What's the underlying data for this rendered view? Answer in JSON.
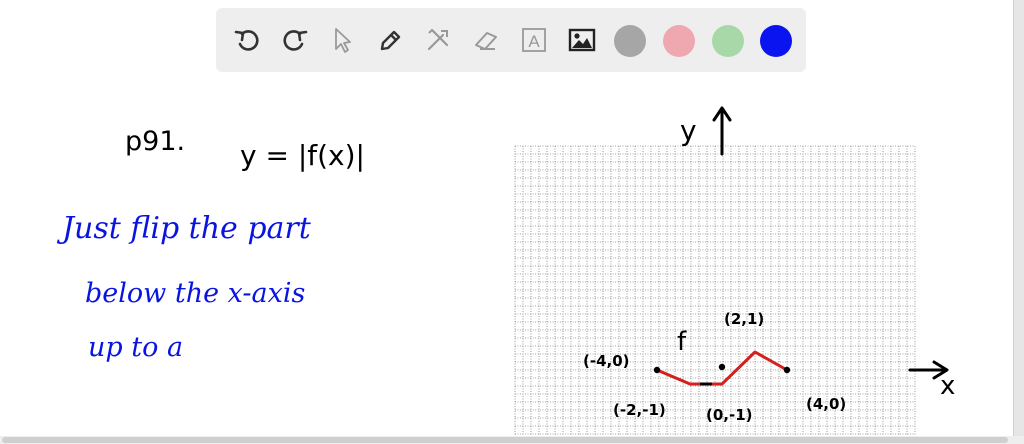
{
  "toolbar": {
    "tools": [
      {
        "name": "undo-icon"
      },
      {
        "name": "redo-icon"
      },
      {
        "name": "pointer-icon"
      },
      {
        "name": "pen-icon"
      },
      {
        "name": "tools-icon"
      },
      {
        "name": "eraser-icon"
      },
      {
        "name": "text-icon",
        "glyph": "A"
      },
      {
        "name": "image-icon"
      }
    ],
    "colors": [
      "#a6a6a6",
      "#f0a8b0",
      "#a8d8a8",
      "#0a14f0"
    ],
    "selected_color": "#0a14f0"
  },
  "canvas": {
    "problem_number": "p91.",
    "equation": "y = |f(x)|",
    "note_lines": [
      "Just flip the part",
      "below the x-axis",
      "up to a"
    ],
    "graph": {
      "y_label": "y",
      "x_label": "x",
      "function_label": "f",
      "point_labels": [
        "(-4,0)",
        "(-2,-1)",
        "(0,-1)",
        "(2,1)",
        "(4,0)"
      ]
    }
  },
  "colors": {
    "ink": "#000000",
    "note": "#0a14e0",
    "curve": "#d41f1f",
    "grid": "#555555"
  }
}
